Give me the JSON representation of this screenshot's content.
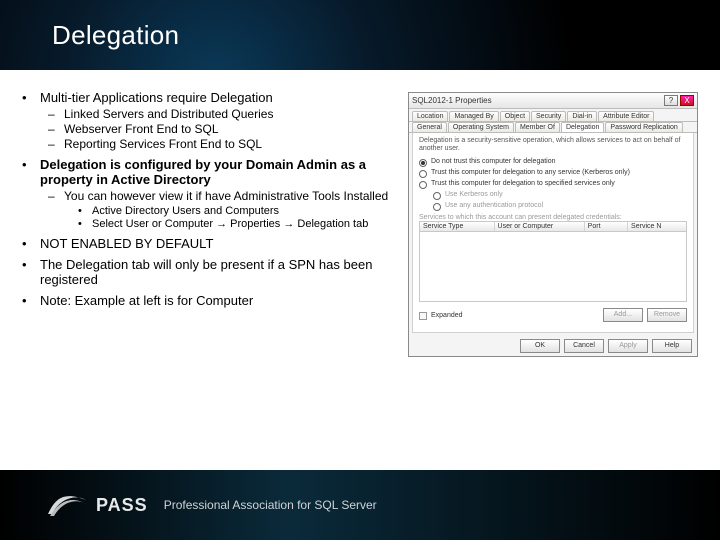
{
  "title": "Delegation",
  "bullets": {
    "b1": {
      "lead": "Multi-tier Applications require Delegation",
      "sub": {
        "s1": "Linked Servers and Distributed Queries",
        "s2": "Webserver Front End to SQL",
        "s3": "Reporting Services Front End to SQL"
      }
    },
    "b2": {
      "lead": "Delegation is configured by your Domain Admin as a property in Active Directory",
      "sub": {
        "s1": "You can however view it if have Administrative Tools Installed",
        "sub2": {
          "a": "Active Directory Users and Computers",
          "b": "Select User or Computer → Properties → Delegation tab"
        }
      }
    },
    "b3": {
      "lead": "NOT ENABLED BY DEFAULT"
    },
    "b4": {
      "lead": "The Delegation tab will only be present if a SPN has been registered"
    },
    "b5": {
      "lead": "Note: Example  at left is for Computer"
    }
  },
  "dialog": {
    "title": "SQL2012-1 Properties",
    "help": "?",
    "close": "X",
    "tabs_row1": {
      "t1": "Location",
      "t2": "Managed By",
      "t3": "Object",
      "t4": "Security",
      "t5": "Dial-in",
      "t6": "Attribute Editor"
    },
    "tabs_row2": {
      "t1": "General",
      "t2": "Operating System",
      "t3": "Member Of",
      "t4": "Delegation",
      "t5": "Password Replication"
    },
    "note": "Delegation is a security-sensitive operation, which allows services to act on behalf of another user.",
    "r1": "Do not trust this computer for delegation",
    "r2": "Trust this computer for delegation to any service (Kerberos only)",
    "r3": "Trust this computer for delegation to specified services only",
    "r3a": "Use Kerberos only",
    "r3b": "Use any authentication protocol",
    "listlabel": "Services to which this account can present delegated credentials:",
    "cols": {
      "c1": "Service Type",
      "c2": "User or Computer",
      "c3": "Port",
      "c4": "Service N"
    },
    "expanded": "Expanded",
    "add": "Add...",
    "remove": "Remove",
    "ok": "OK",
    "cancel": "Cancel",
    "apply": "Apply",
    "helpbtn": "Help"
  },
  "footer": {
    "brand": "PASS",
    "sub": "Professional Association for SQL Server"
  }
}
